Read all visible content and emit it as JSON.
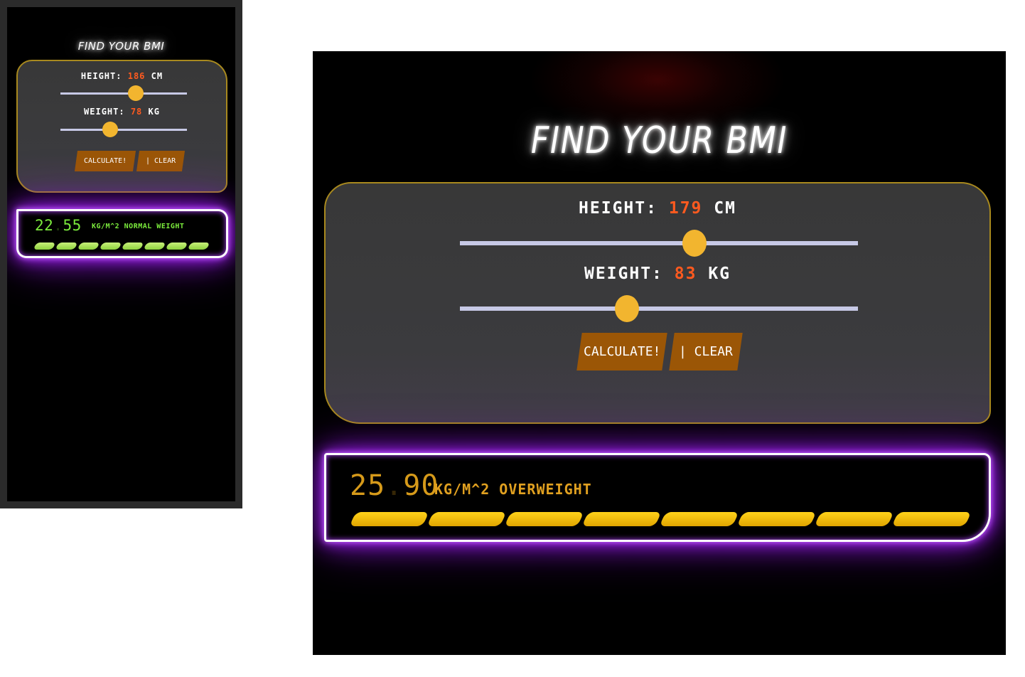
{
  "mobile": {
    "title": "Find your BMI",
    "height_label": "HEIGHT:",
    "height_value": "186",
    "height_unit": "CM",
    "height_level": 0.6,
    "weight_label": "WEIGHT:",
    "weight_value": "78",
    "weight_unit": "KG",
    "weight_level": 0.4,
    "calculate_label": "Calculate!",
    "clear_label": "| Clear",
    "bmi_int": "22",
    "bmi_sep": ".",
    "bmi_frac": "55",
    "bmi_unit": "KG/M^2",
    "bmi_category": "NORMAL WEIGHT",
    "bmi_color": "#7bea3c",
    "segment_count": 8
  },
  "desktop": {
    "title": "Find your BMI",
    "height_label": "HEIGHT:",
    "height_value": "179",
    "height_unit": "CM",
    "height_level": 0.59,
    "weight_label": "WEIGHT:",
    "weight_value": "83",
    "weight_unit": "KG",
    "weight_level": 0.42,
    "calculate_label": "Calculate!",
    "clear_label": "| Clear",
    "bmi_int": "25",
    "bmi_sep": ".",
    "bmi_frac": "90",
    "bmi_unit": "KG/M^2",
    "bmi_category": "OVERWEIGHT",
    "bmi_color": "#d69a1a",
    "segment_count": 8
  },
  "colors": {
    "card_border": "#a8891e",
    "slider_track": "#c7c9e6",
    "slider_thumb": "#f2b52f",
    "button_bg": "#9b5606",
    "value_highlight": "#ff5a1f",
    "panel_glow": "#a020f0"
  }
}
